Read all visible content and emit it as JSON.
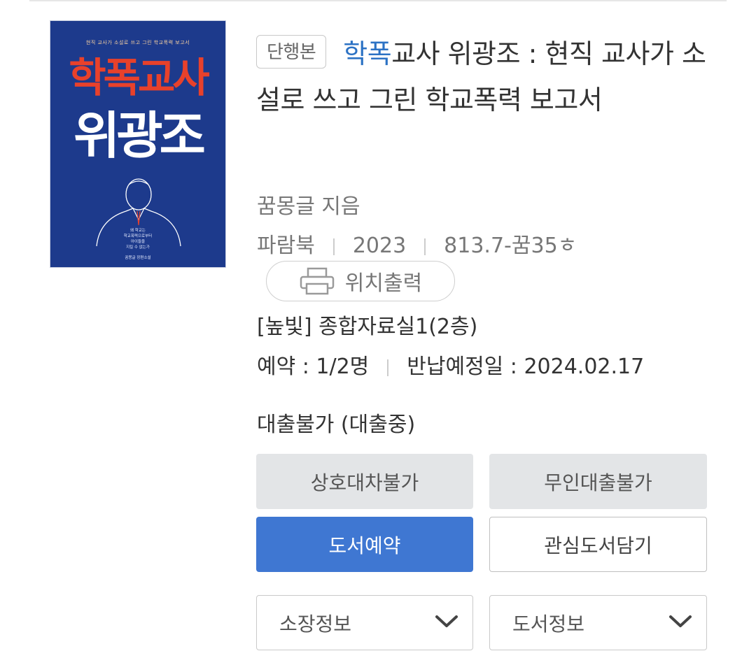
{
  "cover": {
    "tagline": "현직 교사가 소설로 쓰고 그린 학교폭력 보고서",
    "title_line1": "학폭교사",
    "title_line2": "위광조",
    "blurb": [
      "왜 학교는",
      "학교폭력으로부터",
      "아이들을",
      "지킬 수 없는가"
    ],
    "author": "꿈몽글 장편소설",
    "bg_color": "#1d3a8c",
    "title1_color": "#e8412b"
  },
  "book": {
    "badge": "단행본",
    "title_highlight": "학폭",
    "title_rest": "교사 위광조 : 현직 교사가 소설로 쓰고 그린 학교폭력 보고서",
    "author_line": "꿈몽글 지음",
    "publisher": "파람북",
    "year": "2023",
    "call_number": "813.7-꿈35ㅎ"
  },
  "location_button": {
    "icon": "printer-icon",
    "label": "위치출력"
  },
  "holding": {
    "room": "[높빛] 종합자료실1(2층)",
    "reservation": "예약 : 1/2명",
    "due_date": "반납예정일 : 2024.02.17"
  },
  "status": "대출불가 (대출중)",
  "buttons": {
    "interlibrary": "상호대차불가",
    "unmanned": "무인대출불가",
    "reserve": "도서예약",
    "wishlist": "관심도서담기"
  },
  "dropdowns": {
    "holdings": "소장정보",
    "bookinfo": "도서정보"
  },
  "colors": {
    "accent": "#3f77d2",
    "highlight": "#2c72c4"
  }
}
